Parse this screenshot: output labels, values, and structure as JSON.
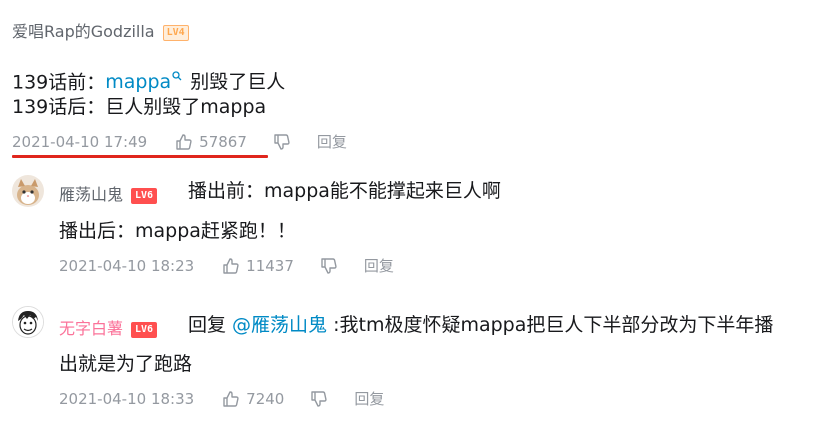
{
  "main_comment": {
    "username": "爱唱Rap的Godzilla",
    "level": "LV4",
    "line1_prefix": "139话前：",
    "line1_link": "mappa",
    "line1_suffix": "别毁了巨人",
    "line2": "139话后：巨人别毁了mappa",
    "time": "2021-04-10 17:49",
    "likes": "57867",
    "reply_label": "回复"
  },
  "replies": [
    {
      "username": "雁荡山鬼",
      "level": "LV6",
      "line1": "播出前：mappa能不能撑起来巨人啊",
      "line2": "播出后：mappa赶紧跑！！",
      "time": "2021-04-10 18:23",
      "likes": "11437",
      "reply_label": "回复"
    },
    {
      "username": "无字白薯",
      "level": "LV6",
      "reply_prefix": "回复 ",
      "mention": "@雁荡山鬼",
      "line1_rest": " :我tm极度怀疑mappa把巨人下半部分改为下半年播",
      "line2": "出就是为了跑路",
      "time": "2021-04-10 18:33",
      "likes": "7240",
      "reply_label": "回复"
    }
  ],
  "icons": {
    "like": "thumbs-up-icon",
    "dislike": "thumbs-down-icon",
    "search": "search-icon"
  },
  "colors": {
    "accent_link": "#008ac5",
    "username_pink": "#fb7299",
    "underline_red": "#e0261d",
    "meta_gray": "#9499a0"
  }
}
